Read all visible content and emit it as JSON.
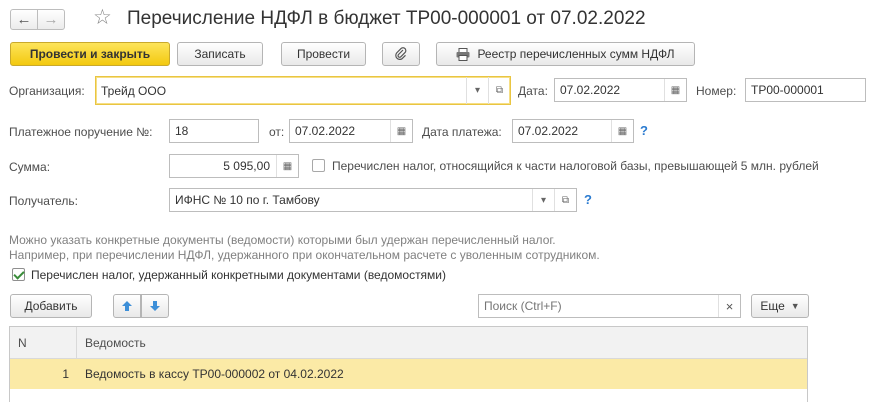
{
  "window": {
    "title": "Перечисление НДФЛ в бюджет ТР00-000001 от 07.02.2022"
  },
  "toolbar": {
    "post_close": "Провести и закрыть",
    "save": "Записать",
    "post": "Провести",
    "registry": "Реестр перечисленных сумм НДФЛ"
  },
  "form": {
    "org_label": "Организация:",
    "org_value": "Трейд ООО",
    "date_label": "Дата:",
    "date_value": "07.02.2022",
    "number_label": "Номер:",
    "number_value": "ТР00-000001",
    "payment_order_label": "Платежное поручение №:",
    "payment_order_value": "18",
    "from_label": "от:",
    "from_value": "07.02.2022",
    "payment_date_label": "Дата платежа:",
    "payment_date_value": "07.02.2022",
    "help": "?",
    "sum_label": "Сумма:",
    "sum_value": "5 095,00",
    "over5m_label": "Перечислен налог, относящийся к части налоговой базы, превышающей 5 млн. рублей",
    "recipient_label": "Получатель:",
    "recipient_value": "ИФНС № 10 по г. Тамбову"
  },
  "hint": {
    "line1": "Можно указать конкретные документы (ведомости) которыми был удержан перечисленный налог.",
    "line2": "Например, при перечислении НДФЛ, удержанного при окончательном расчете с уволенным сотрудником."
  },
  "specific_docs": {
    "label": "Перечислен налог, удержанный конкретными документами (ведомостями)",
    "checked": true
  },
  "table_toolbar": {
    "add": "Добавить",
    "search_placeholder": "Поиск (Ctrl+F)",
    "clear": "×",
    "more": "Еще"
  },
  "table": {
    "columns": [
      "N",
      "Ведомость"
    ],
    "rows": [
      {
        "n": "1",
        "doc": "Ведомость в кассу ТР00-000002 от 04.02.2022"
      }
    ]
  },
  "colors": {
    "primary": "#f3c90f",
    "selected_row": "#fbeaa6",
    "help": "#2b7bd0",
    "arrows": "#3d8fd8"
  }
}
